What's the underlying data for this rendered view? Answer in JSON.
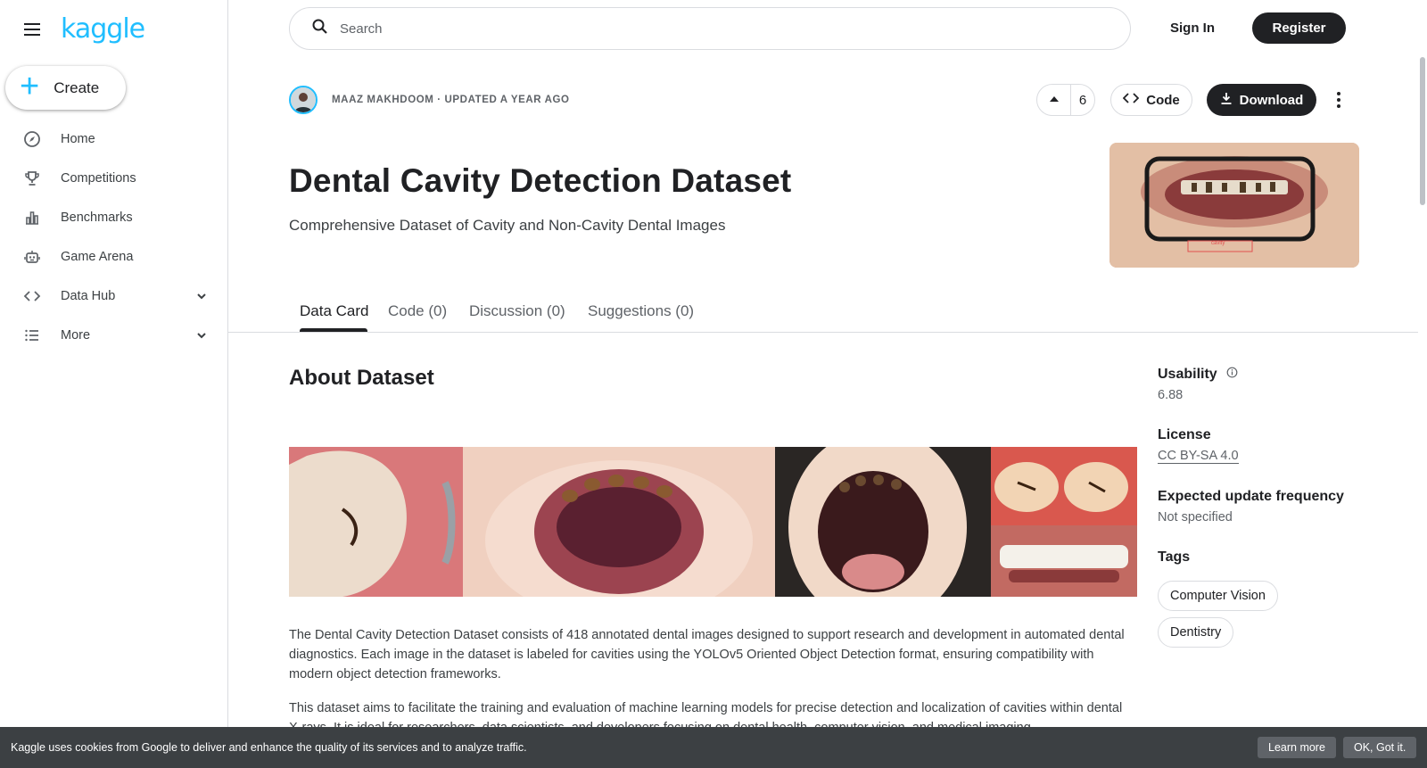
{
  "sidebar": {
    "logo": "kaggle",
    "create_label": "Create",
    "items": [
      {
        "label": "Home",
        "icon": "compass-icon"
      },
      {
        "label": "Competitions",
        "icon": "trophy-icon"
      },
      {
        "label": "Benchmarks",
        "icon": "bar-chart-icon"
      },
      {
        "label": "Game Arena",
        "icon": "robot-icon"
      },
      {
        "label": "Data Hub",
        "icon": "code-icon"
      },
      {
        "label": "More",
        "icon": "list-icon"
      }
    ]
  },
  "header": {
    "search_placeholder": "Search",
    "signin_label": "Sign In",
    "register_label": "Register"
  },
  "dataset": {
    "meta": "Maaz Makhdoom · Updated a year ago",
    "upvotes": "6",
    "code_label": "Code",
    "download_label": "Download",
    "title": "Dental Cavity Detection Dataset",
    "subtitle": "Comprehensive Dataset of Cavity and Non-Cavity Dental Images",
    "thumb_label": "cavity"
  },
  "tabs": [
    {
      "label": "Data Card"
    },
    {
      "label": "Code (0)"
    },
    {
      "label": "Discussion (0)"
    },
    {
      "label": "Suggestions (0)"
    }
  ],
  "main": {
    "heading": "About Dataset",
    "para1": "The Dental Cavity Detection Dataset consists of 418 annotated dental images designed to support research and development in automated dental diagnostics. Each image in the dataset is labeled for cavities using the YOLOv5 Oriented Object Detection format, ensuring compatibility with modern object detection frameworks.",
    "para2": "This dataset aims to facilitate the training and evaluation of machine learning models for precise detection and localization of cavities within dental X-rays. It is ideal for researchers, data scientists, and developers focusing on dental health, computer vision, and medical imaging."
  },
  "right": {
    "usability_label": "Usability",
    "usability_value": "6.88",
    "license_label": "License",
    "license_value": "CC BY-SA 4.0",
    "update_label": "Expected update frequency",
    "update_value": "Not specified",
    "tags_label": "Tags",
    "tags": [
      "Computer Vision",
      "Dentistry"
    ]
  },
  "cookie": {
    "text": "Kaggle uses cookies from Google to deliver and enhance the quality of its services and to analyze traffic.",
    "learn_more": "Learn more",
    "ok": "OK, Got it."
  },
  "colors": {
    "brand": "#20beff",
    "dark_button": "#202124",
    "cookie_bar": "#3c4043"
  }
}
